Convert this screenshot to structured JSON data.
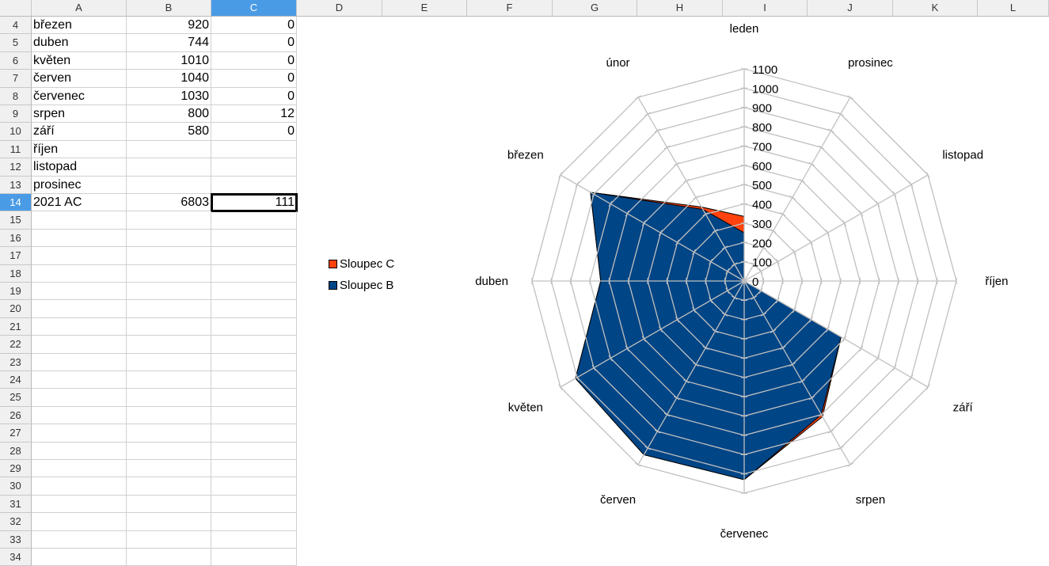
{
  "columns": [
    "A",
    "B",
    "C",
    "D",
    "E",
    "F",
    "G",
    "H",
    "I",
    "J",
    "K",
    "L"
  ],
  "selected_column": "C",
  "rows": [
    {
      "n": "4",
      "a": "březen",
      "b": "920",
      "c": "0"
    },
    {
      "n": "5",
      "a": "duben",
      "b": "744",
      "c": "0"
    },
    {
      "n": "6",
      "a": "květen",
      "b": "1010",
      "c": "0"
    },
    {
      "n": "7",
      "a": "červen",
      "b": "1040",
      "c": "0"
    },
    {
      "n": "8",
      "a": "červenec",
      "b": "1030",
      "c": "0"
    },
    {
      "n": "9",
      "a": "srpen",
      "b": "800",
      "c": "12"
    },
    {
      "n": "10",
      "a": "září",
      "b": "580",
      "c": "0"
    },
    {
      "n": "11",
      "a": "říjen",
      "b": "",
      "c": ""
    },
    {
      "n": "12",
      "a": "listopad",
      "b": "",
      "c": ""
    },
    {
      "n": "13",
      "a": "prosinec",
      "b": "",
      "c": ""
    },
    {
      "n": "14",
      "a": "2021 AC",
      "b": "6803",
      "c": "111"
    },
    {
      "n": "15"
    },
    {
      "n": "16"
    },
    {
      "n": "17"
    },
    {
      "n": "18"
    },
    {
      "n": "19"
    },
    {
      "n": "20"
    },
    {
      "n": "21"
    },
    {
      "n": "22"
    },
    {
      "n": "23"
    },
    {
      "n": "24"
    },
    {
      "n": "25"
    },
    {
      "n": "26"
    },
    {
      "n": "27"
    },
    {
      "n": "28"
    },
    {
      "n": "29"
    },
    {
      "n": "30"
    },
    {
      "n": "31"
    },
    {
      "n": "32"
    },
    {
      "n": "33"
    },
    {
      "n": "34"
    }
  ],
  "selected_row": "14",
  "chart_data": {
    "type": "radar-filled-stacked",
    "categories": [
      "leden",
      "únor",
      "březen",
      "duben",
      "květen",
      "červen",
      "červenec",
      "srpen",
      "září",
      "říjen",
      "listopad",
      "prosinec"
    ],
    "series": [
      {
        "name": "Sloupec B",
        "color": "#004586",
        "values": [
          250,
          429,
          920,
          744,
          1010,
          1040,
          1030,
          800,
          580,
          0,
          0,
          0
        ]
      },
      {
        "name": "Sloupec C",
        "color": "#ff420e",
        "values": [
          85,
          14,
          0,
          0,
          0,
          0,
          0,
          12,
          0,
          0,
          0,
          0
        ]
      }
    ],
    "rlim": [
      0,
      1100
    ],
    "ticks": [
      "0",
      "100",
      "200",
      "300",
      "400",
      "500",
      "600",
      "700",
      "800",
      "900",
      "1000",
      "1100"
    ],
    "legend": [
      "Sloupec C",
      "Sloupec B"
    ],
    "legend_placement": "left"
  }
}
